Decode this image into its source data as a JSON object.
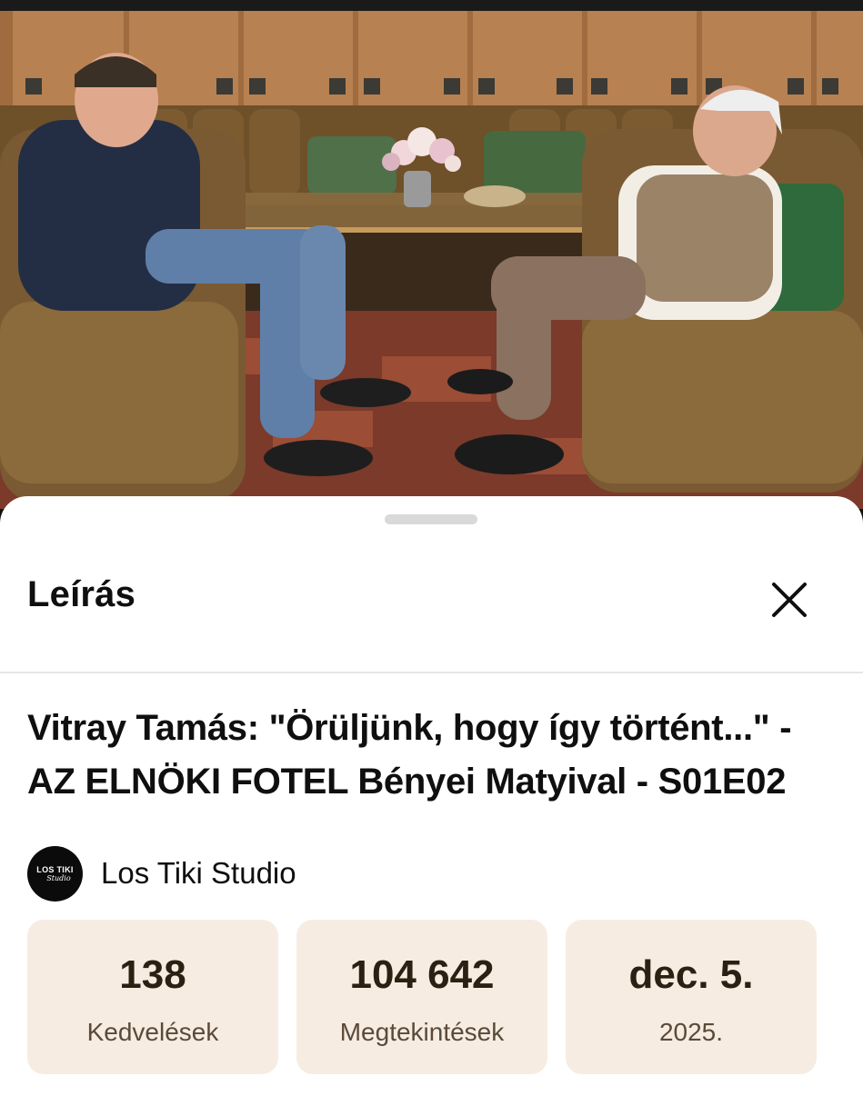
{
  "sheet": {
    "title": "Leírás",
    "close_icon": "close-icon"
  },
  "video": {
    "title": "Vitray Tamás: \"Örüljünk, hogy így történt...\" - AZ ELNÖKI FOTEL Bényei Matyival - S01E02",
    "thumbnail": "interview-scene-two-men-in-armchairs"
  },
  "channel": {
    "name": "Los Tiki Studio",
    "avatar_text_1": "LOS TIKI",
    "avatar_text_2": "Studio"
  },
  "stats": [
    {
      "value": "138",
      "label": "Kedvelések"
    },
    {
      "value": "104 642",
      "label": "Megtekintések"
    },
    {
      "value": "dec. 5.",
      "label": "2025."
    }
  ],
  "colors": {
    "stat_background": "#f6ece2",
    "stat_value": "#2b2012",
    "text_primary": "#0f0f0f"
  }
}
